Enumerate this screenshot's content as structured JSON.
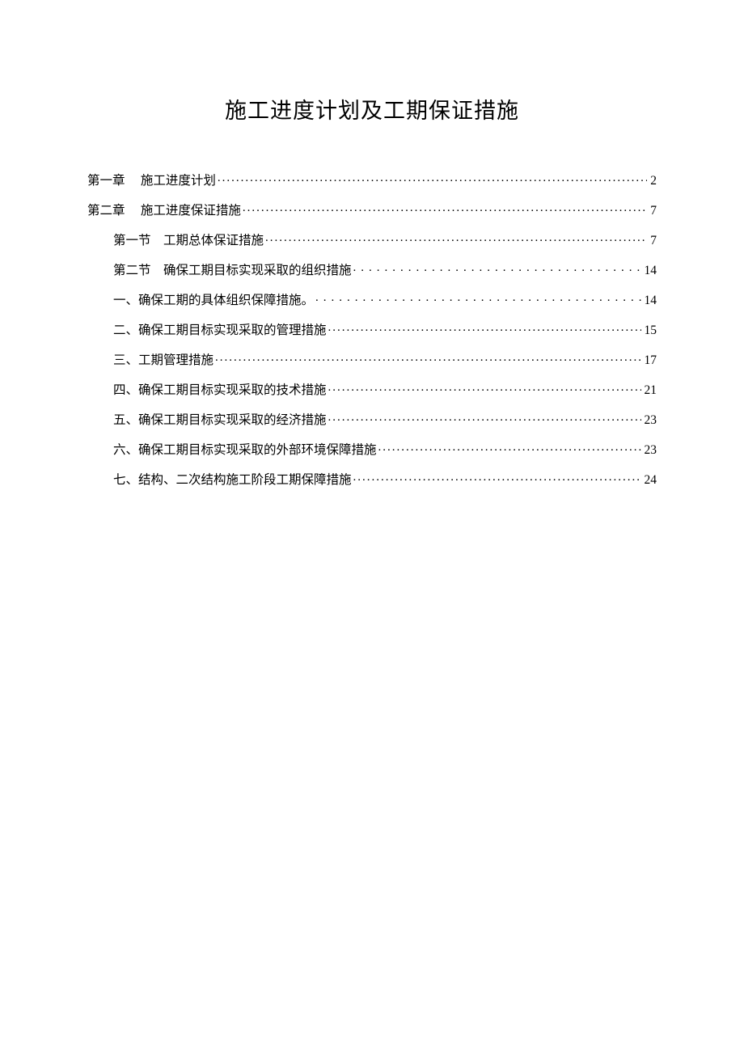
{
  "title": "施工进度计划及工期保证措施",
  "toc": [
    {
      "level": 1,
      "label": "第一章　 施工进度计划",
      "page": "2",
      "leader": "dot"
    },
    {
      "level": 1,
      "label": "第二章　 施工进度保证措施",
      "page": "7",
      "leader": "dot"
    },
    {
      "level": 2,
      "label": "第一节　工期总体保证措施",
      "page": "7",
      "leader": "dot"
    },
    {
      "level": 2,
      "label": "第二节　确保工期目标实现采取的组织措施",
      "page": "14",
      "leader": "wide"
    },
    {
      "level": 2,
      "label": "一、确保工期的具体组织保障措施。",
      "page": "14",
      "leader": "wide"
    },
    {
      "level": 2,
      "label": "二、确保工期目标实现采取的管理措施",
      "page": "15",
      "leader": "dot"
    },
    {
      "level": 2,
      "label": "三、工期管理措施",
      "page": "17",
      "leader": "dot"
    },
    {
      "level": 2,
      "label": "四、确保工期目标实现采取的技术措施",
      "page": "21",
      "leader": "dot"
    },
    {
      "level": 2,
      "label": "五、确保工期目标实现采取的经济措施",
      "page": "23",
      "leader": "dot"
    },
    {
      "level": 2,
      "label": "六、确保工期目标实现采取的外部环境保障措施",
      "page": "23",
      "leader": "dot"
    },
    {
      "level": 2,
      "label": "七、结构、二次结构施工阶段工期保障措施",
      "page": "24",
      "leader": "dot"
    }
  ]
}
